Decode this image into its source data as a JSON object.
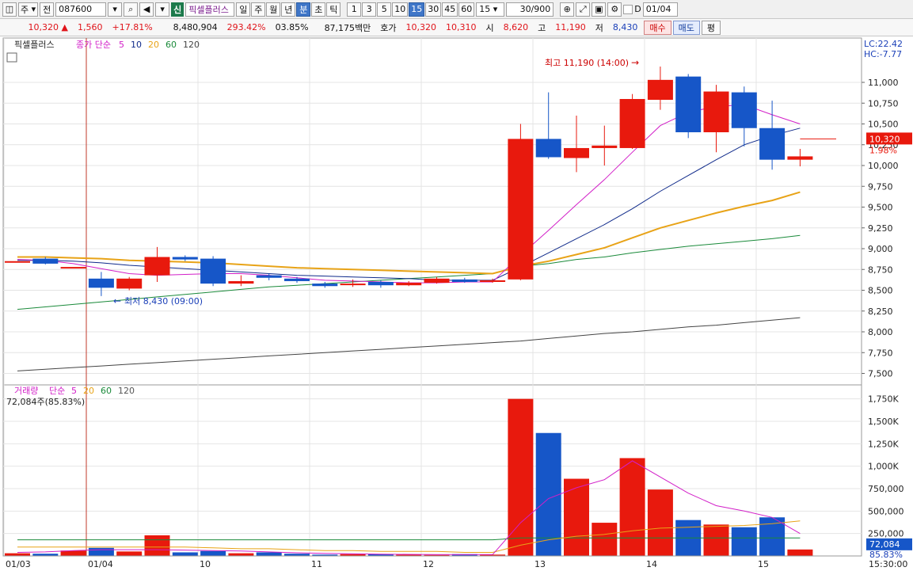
{
  "toolbar": {
    "market": "주",
    "prev_label": "전",
    "code": "087600",
    "new_tag": "신",
    "stock_name": "픽셀플러스",
    "periods": [
      "일",
      "주",
      "월",
      "년",
      "분",
      "초",
      "틱"
    ],
    "active_period": "분",
    "intervals": [
      "1",
      "3",
      "5",
      "10",
      "15",
      "30",
      "45",
      "60"
    ],
    "active_interval": "15",
    "interval_select": "15",
    "count": "30",
    "count_total": "/900",
    "date_check_label": "D",
    "date": "01/04"
  },
  "infobar": {
    "price": "10,320",
    "change_arrow": "▲",
    "change": "1,560",
    "change_pct": "+17.81%",
    "volume": "8,480,904",
    "turnover_pct": "293.42%",
    "ratio": "03.85%",
    "amount": "87,175백만",
    "quote_label": "호가",
    "ask": "10,320",
    "bid": "10,310",
    "open_label": "시",
    "open": "8,620",
    "high_label": "고",
    "high": "11,190",
    "low_label": "저",
    "low": "8,430",
    "buy_label": "매수",
    "sell_label": "매도",
    "eval_label": "평"
  },
  "price_panel": {
    "title": "픽셀플러스",
    "ma_label": "종가 단순",
    "ma_periods": [
      "5",
      "10",
      "20",
      "60",
      "120"
    ],
    "lc": "LC:22.42",
    "hc": "HC:-7.77",
    "y_ticks": [
      "11,000",
      "10,750",
      "10,500",
      "10,250",
      "10,000",
      "9,750",
      "9,500",
      "9,250",
      "9,000",
      "8,750",
      "8,500",
      "8,250",
      "8,000",
      "7,750",
      "7,500"
    ],
    "current_price_tag": "10,320",
    "current_pct_tag": "1.98%",
    "high_annotation": "최고 11,190 (14:00)",
    "low_annotation": "최저 8,430 (09:00)"
  },
  "volume_panel": {
    "title": "거래량",
    "ma_label": "단순",
    "ma_periods": [
      "5",
      "20",
      "60",
      "120"
    ],
    "current_volume": "72,084주(85.83%)",
    "y_ticks": [
      "1,750K",
      "1,500K",
      "1,250K",
      "1,000K",
      "750,000",
      "500,000",
      "250,000"
    ],
    "current_tag": "72,084",
    "current_pct_tag": "85.83%"
  },
  "x_axis": {
    "labels": [
      "01/03",
      "01/04",
      "10",
      "11",
      "12",
      "13",
      "14",
      "15"
    ],
    "right_time": "15:30:00"
  },
  "colors": {
    "up": "#e8190d",
    "down": "#1656c8",
    "ma5": "#d21fc8",
    "ma10": "#0f2a8a",
    "ma20": "#e8a317",
    "ma60": "#1a8a3a",
    "ma120": "#444444"
  },
  "chart_data": {
    "type": "candlestick",
    "candles": [
      {
        "x": "prev",
        "open": 8850,
        "close": 8850,
        "high": 8850,
        "low": 8850
      },
      {
        "x": "prev",
        "open": 8880,
        "close": 8820,
        "high": 8900,
        "low": 8810
      },
      {
        "x": "prev",
        "open": 8780,
        "close": 8780,
        "high": 8780,
        "low": 8780
      },
      {
        "x": "01/04 09:00",
        "open": 8640,
        "close": 8530,
        "high": 8720,
        "low": 8430
      },
      {
        "x": "09:15",
        "open": 8520,
        "close": 8640,
        "high": 8660,
        "low": 8500
      },
      {
        "x": "09:30",
        "open": 8680,
        "close": 8900,
        "high": 9020,
        "low": 8600
      },
      {
        "x": "09:45",
        "open": 8900,
        "close": 8870,
        "high": 8920,
        "low": 8850
      },
      {
        "x": "10:00",
        "open": 8880,
        "close": 8580,
        "high": 8910,
        "low": 8550
      },
      {
        "x": "10:15",
        "open": 8580,
        "close": 8610,
        "high": 8680,
        "low": 8550
      },
      {
        "x": "10:30",
        "open": 8680,
        "close": 8650,
        "high": 8700,
        "low": 8620
      },
      {
        "x": "10:45",
        "open": 8640,
        "close": 8610,
        "high": 8660,
        "low": 8590
      },
      {
        "x": "11:00",
        "open": 8580,
        "close": 8550,
        "high": 8600,
        "low": 8530
      },
      {
        "x": "11:15",
        "open": 8570,
        "close": 8580,
        "high": 8630,
        "low": 8540
      },
      {
        "x": "11:30",
        "open": 8600,
        "close": 8560,
        "high": 8620,
        "low": 8530
      },
      {
        "x": "11:45",
        "open": 8560,
        "close": 8590,
        "high": 8610,
        "low": 8550
      },
      {
        "x": "12:00",
        "open": 8590,
        "close": 8640,
        "high": 8660,
        "low": 8580
      },
      {
        "x": "12:15",
        "open": 8630,
        "close": 8600,
        "high": 8650,
        "low": 8590
      },
      {
        "x": "12:30",
        "open": 8600,
        "close": 8620,
        "high": 8640,
        "low": 8590
      },
      {
        "x": "12:45",
        "open": 8630,
        "close": 10320,
        "high": 10500,
        "low": 8620
      },
      {
        "x": "13:00",
        "open": 10320,
        "close": 10100,
        "high": 10880,
        "low": 10080
      },
      {
        "x": "13:15",
        "open": 10090,
        "close": 10210,
        "high": 10600,
        "low": 9920
      },
      {
        "x": "13:30",
        "open": 10210,
        "close": 10240,
        "high": 10480,
        "low": 10000
      },
      {
        "x": "13:45",
        "open": 10210,
        "close": 10800,
        "high": 10860,
        "low": 10200
      },
      {
        "x": "14:00",
        "open": 10790,
        "close": 11030,
        "high": 11190,
        "low": 10670
      },
      {
        "x": "14:15",
        "open": 11070,
        "close": 10400,
        "high": 11100,
        "low": 10330
      },
      {
        "x": "14:30",
        "open": 10400,
        "close": 10890,
        "high": 10970,
        "low": 10160
      },
      {
        "x": "14:45",
        "open": 10880,
        "close": 10450,
        "high": 10950,
        "low": 10230
      },
      {
        "x": "15:00",
        "open": 10450,
        "close": 10070,
        "high": 10780,
        "low": 9950
      },
      {
        "x": "15:15",
        "open": 10070,
        "close": 10110,
        "high": 10200,
        "low": 9990
      }
    ],
    "volumes": [
      30000,
      25000,
      60000,
      90000,
      50000,
      230000,
      40000,
      55000,
      30000,
      40000,
      25000,
      15000,
      20000,
      18000,
      15000,
      12000,
      20000,
      15000,
      1750000,
      1370000,
      860000,
      370000,
      1090000,
      740000,
      400000,
      350000,
      320000,
      430000,
      72084
    ],
    "ma5": [
      8870,
      8860,
      8820,
      8760,
      8700,
      8680,
      8690,
      8700,
      8700,
      8680,
      8650,
      8620,
      8610,
      8600,
      8590,
      8590,
      8600,
      8600,
      8920,
      9220,
      9530,
      9830,
      10160,
      10480,
      10640,
      10710,
      10730,
      10610,
      10500
    ],
    "ma10": [
      8860,
      8860,
      8850,
      8830,
      8800,
      8780,
      8760,
      8740,
      8720,
      8700,
      8680,
      8670,
      8660,
      8650,
      8640,
      8620,
      8620,
      8620,
      8780,
      8950,
      9120,
      9290,
      9480,
      9690,
      9880,
      10070,
      10250,
      10360,
      10450
    ],
    "ma20": [
      8900,
      8900,
      8890,
      8880,
      8860,
      8850,
      8840,
      8830,
      8810,
      8790,
      8770,
      8760,
      8750,
      8740,
      8730,
      8720,
      8710,
      8700,
      8790,
      8850,
      8930,
      9010,
      9130,
      9250,
      9340,
      9430,
      9510,
      9580,
      9680
    ],
    "ma60": [
      8270,
      8300,
      8330,
      8360,
      8390,
      8420,
      8450,
      8480,
      8510,
      8540,
      8560,
      8580,
      8600,
      8620,
      8640,
      8660,
      8680,
      8700,
      8790,
      8820,
      8870,
      8900,
      8950,
      8990,
      9030,
      9060,
      9090,
      9120,
      9160
    ],
    "ma120": [
      7530,
      7550,
      7570,
      7590,
      7610,
      7630,
      7650,
      7670,
      7690,
      7710,
      7730,
      7750,
      7770,
      7790,
      7810,
      7830,
      7850,
      7870,
      7890,
      7920,
      7950,
      7980,
      8000,
      8030,
      8060,
      8080,
      8110,
      8140,
      8170
    ],
    "vol_ma5": [
      40000,
      45000,
      60000,
      70000,
      70000,
      70000,
      65000,
      60000,
      55000,
      45000,
      35000,
      28000,
      25000,
      20000,
      18000,
      16000,
      16000,
      15000,
      370000,
      640000,
      760000,
      850000,
      1060000,
      880000,
      700000,
      560000,
      500000,
      430000,
      250000
    ],
    "vol_ma20": [
      100000,
      100000,
      100000,
      100000,
      100000,
      100000,
      100000,
      90000,
      80000,
      80000,
      70000,
      60000,
      60000,
      50000,
      50000,
      50000,
      40000,
      40000,
      120000,
      180000,
      220000,
      240000,
      280000,
      310000,
      320000,
      330000,
      340000,
      360000,
      390000
    ],
    "vol_ma60": [
      180000,
      180000,
      180000,
      180000,
      180000,
      180000,
      180000,
      180000,
      180000,
      180000,
      180000,
      180000,
      180000,
      180000,
      180000,
      180000,
      180000,
      180000,
      200000,
      200000,
      200000,
      200000,
      200000,
      200000,
      200000,
      200000,
      200000,
      200000,
      200000
    ],
    "price_ylim": [
      7400,
      11400
    ],
    "volume_ylim": [
      0,
      1800000
    ]
  }
}
